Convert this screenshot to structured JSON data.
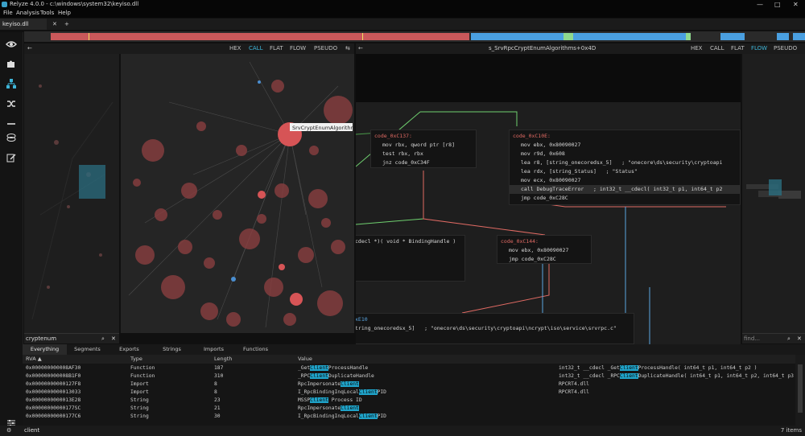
{
  "window": {
    "title": "Relyze 4.0.0 - c:\\windows\\system32\\keyiso.dll",
    "controls": [
      "—",
      "□",
      "✕"
    ]
  },
  "menu": [
    "File",
    "Analysis",
    "Tools",
    "Help"
  ],
  "tabs": {
    "active": "keyiso.dll",
    "close": "✕",
    "add": "+"
  },
  "sidebar": {
    "icons": [
      "eye-icon",
      "puzzle-icon",
      "hierarchy-icon",
      "shuffle-icon",
      "minus-icon",
      "layers-icon",
      "edit-icon",
      "settings-sliders-icon"
    ]
  },
  "call_graph_panel": {
    "views": [
      "HEX",
      "CALL",
      "FLAT",
      "FLOW",
      "PSEUDO"
    ],
    "active_view": "CALL",
    "collapse": "⇆",
    "node_tooltip": "SrvCryptEnumAlgorithms",
    "search_value": "cryptenum",
    "search_icon": "⌕",
    "search_close": "✕"
  },
  "flow_panel": {
    "title": "s_SrvRpcCryptEnumAlgorithms+0x4D",
    "views": [
      "HEX",
      "CALL",
      "FLAT",
      "FLOW",
      "PSEUDO"
    ],
    "active_view": "FLOW",
    "block1": {
      "label": "code_0xC137:",
      "lines": [
        "mov rbx, qword ptr [r8]",
        "test rbx, rbx",
        "jnz code_0xC34F"
      ]
    },
    "block2": {
      "label": "code_0xC10E:",
      "lines": [
        "mov ebx, 0x80090027",
        "mov r9d, 0x608",
        "lea r8, [string_onecoredsx_5]   ; \"onecore\\ds\\security\\cryptoapi",
        "lea rdx, [string_Status]   ; \"Status\"",
        "mov ecx, 0x80090027",
        "call DebugTraceError   ; int32_t __cdecl( int32_t p1, int64_t p2",
        "jmp code_0xC28C"
      ]
    },
    "block3": {
      "label": "code_0xC144:",
      "lines": [
        "mov ebx, 0x80090027",
        "jmp code_0xC28C"
      ]
    },
    "block4": {
      "lines": [
        "cdecl *)( void * BindingHandle )"
      ]
    },
    "block5": {
      "lines": [
        "xE10",
        "tring_onecoredsx_5]   ; \"onecore\\ds\\security\\cryptoapi\\ncrypt\\iso\\service\\srvrpc.c\""
      ]
    },
    "minimap_search": "find..."
  },
  "bottom_panel": {
    "tabs": [
      "Everything",
      "Segments",
      "Exports",
      "Strings",
      "Imports",
      "Functions"
    ],
    "active_tab": "Everything",
    "columns": [
      "RVA ▲",
      "Type",
      "Length",
      "Value"
    ],
    "rows": [
      {
        "rva": "0x000000000008AF30",
        "type": "Function",
        "length": "187",
        "pre": "_Get",
        "match": "Client",
        "post": "ProcessHandle",
        "detail": "int32_t __cdecl _Get",
        "detail_match": "Client",
        "detail_post": "ProcessHandle( int64_t p1, int64_t p2 )"
      },
      {
        "rva": "0x000000000008B1F0",
        "type": "Function",
        "length": "310",
        "pre": "_RPC",
        "match": "Client",
        "post": "DuplicateHandle",
        "detail": "int32_t __cdecl _RPC",
        "detail_match": "Client",
        "detail_post": "DuplicateHandle( int64_t p1, int64_t p2, int64_t p3 )"
      },
      {
        "rva": "0x00000000000127F8",
        "type": "Import",
        "length": "8",
        "pre": "RpcImpersonate",
        "match": "Client",
        "post": "",
        "detail": "RPCRT4.dll",
        "detail_match": "",
        "detail_post": ""
      },
      {
        "rva": "0x0000000000013033",
        "type": "Import",
        "length": "8",
        "pre": "I_RpcBindingInqLocal",
        "match": "Client",
        "post": "PID",
        "detail": "RPCRT4.dll",
        "detail_match": "",
        "detail_post": ""
      },
      {
        "rva": "0x0000000000013E28",
        "type": "String",
        "length": "23",
        "pre": "MSSP",
        "match": "Client",
        "post": " Process ID",
        "detail": "",
        "detail_match": "",
        "detail_post": ""
      },
      {
        "rva": "0x00000000000177SC",
        "type": "String",
        "length": "21",
        "pre": "RpcImpersonate",
        "match": "Client",
        "post": "",
        "detail": "",
        "detail_match": "",
        "detail_post": ""
      },
      {
        "rva": "0x00000000000177C6",
        "type": "String",
        "length": "30",
        "pre": "I_RpcBindingInqLocal",
        "match": "Client",
        "post": "PID",
        "detail": "",
        "detail_match": "",
        "detail_post": ""
      }
    ]
  },
  "status": {
    "query": "client",
    "count": "7 items",
    "settings_icon": "⚙"
  }
}
